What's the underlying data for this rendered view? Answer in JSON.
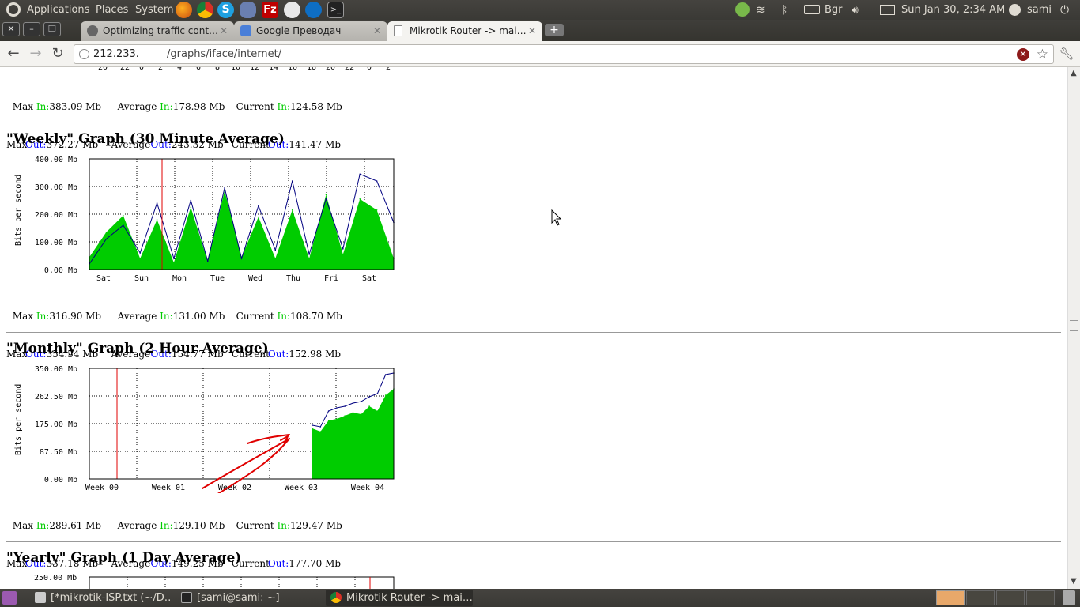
{
  "top_panel": {
    "menus": [
      "Applications",
      "Places",
      "System"
    ],
    "keyboard_layout": "Bgr",
    "clock": "Sun Jan 30,  2:34 AM",
    "user": "sami"
  },
  "tabs": [
    {
      "title": "Optimizing traffic cont…",
      "active": false
    },
    {
      "title": "Google Преводач",
      "active": false
    },
    {
      "title": "Mikrotik Router -> mai…",
      "active": true
    }
  ],
  "address_bar": {
    "host": "212.233.",
    "path": "/graphs/iface/internet/"
  },
  "daily_stats": {
    "max_in": "383.09 Mb",
    "avg_in": "178.98 Mb",
    "cur_in": "124.58 Mb",
    "max_out": "372.27 Mb",
    "avg_out": "243.32 Mb",
    "cur_out": "141.47 Mb"
  },
  "labels": {
    "max": "Max",
    "average": "Average",
    "current": "Current",
    "in": "In:",
    "out": "Out:",
    "ylabel": "Bits per second"
  },
  "weekly": {
    "title": "\"Weekly\" Graph (30 Minute Average)",
    "stats": {
      "max_in": "316.90 Mb",
      "avg_in": "131.00 Mb",
      "cur_in": "108.70 Mb",
      "max_out": "354.54 Mb",
      "avg_out": "154.77 Mb",
      "cur_out": "152.98 Mb"
    }
  },
  "monthly": {
    "title": "\"Monthly\" Graph (2 Hour Average)",
    "stats": {
      "max_in": "289.61 Mb",
      "avg_in": "129.10 Mb",
      "cur_in": "129.47 Mb",
      "max_out": "337.18 Mb",
      "avg_out": "149.25 Mb",
      "cur_out": "177.70 Mb"
    }
  },
  "yearly": {
    "title": "\"Yearly\" Graph (1 Day Average)",
    "top_tick": "250.00 Mb"
  },
  "chart_data": [
    {
      "type": "area",
      "title": "\"Weekly\" Graph (30 Minute Average)",
      "ylabel": "Bits per second",
      "ylim": [
        0,
        400
      ],
      "y_ticks": [
        "0.00 Mb",
        "100.00 Mb",
        "200.00 Mb",
        "300.00 Mb",
        "400.00 Mb"
      ],
      "categories": [
        "Sat",
        "Sun",
        "Mon",
        "Tue",
        "Wed",
        "Thu",
        "Fri",
        "Sat"
      ],
      "grid": true,
      "series": [
        {
          "name": "In",
          "color": "#00cc00",
          "values": [
            45,
            135,
            195,
            40,
            180,
            25,
            225,
            30,
            285,
            45,
            190,
            40,
            215,
            40,
            270,
            55,
            255,
            215,
            40
          ]
        },
        {
          "name": "Out",
          "color": "#000080",
          "values": [
            20,
            110,
            160,
            60,
            240,
            40,
            250,
            30,
            295,
            40,
            230,
            70,
            320,
            55,
            255,
            75,
            345,
            320,
            170
          ]
        }
      ]
    },
    {
      "type": "area",
      "title": "\"Monthly\" Graph (2 Hour Average)",
      "ylabel": "Bits per second",
      "ylim": [
        0,
        350
      ],
      "y_ticks": [
        "0.00 Mb",
        "87.50 Mb",
        "175.00 Mb",
        "262.50 Mb",
        "350.00 Mb"
      ],
      "categories": [
        "Week 00",
        "Week 01",
        "Week 02",
        "Week 03",
        "Week 04"
      ],
      "grid": true,
      "series": [
        {
          "name": "In",
          "color": "#00cc00",
          "values": [
            160,
            150,
            185,
            190,
            200,
            210,
            205,
            230,
            215,
            265,
            285
          ]
        },
        {
          "name": "Out",
          "color": "#000080",
          "values": [
            170,
            165,
            215,
            225,
            230,
            240,
            245,
            260,
            270,
            330,
            335
          ]
        }
      ]
    }
  ],
  "taskbar": [
    {
      "label": "[*mikrotik-ISP.txt (~/D…",
      "active": false
    },
    {
      "label": "[sami@sami: ~]",
      "active": false
    },
    {
      "label": "Mikrotik Router -> mai…",
      "active": true
    }
  ]
}
